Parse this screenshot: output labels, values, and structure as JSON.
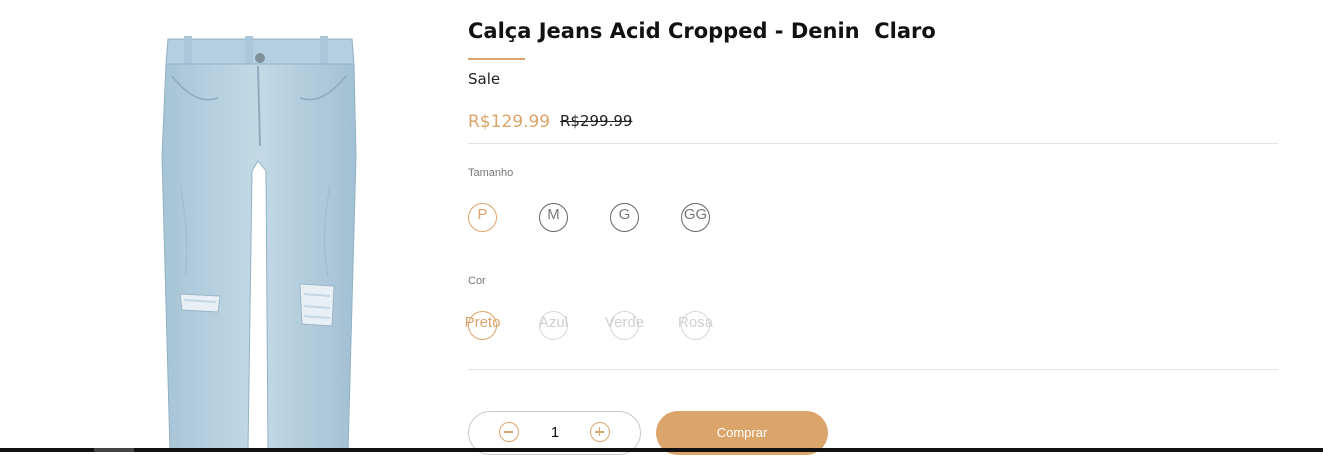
{
  "product": {
    "title": "Calça Jeans Acid Cropped - Denin  Claro",
    "sale_label": "Sale",
    "price_current": "R$129.99",
    "price_old": "R$299.99",
    "image_alt": "jeans-photo"
  },
  "size": {
    "label": "Tamanho",
    "options": [
      "P",
      "M",
      "G",
      "GG"
    ],
    "selected": "P"
  },
  "color": {
    "label": "Cor",
    "options": [
      "Preto",
      "Azul",
      "Verde",
      "Rosa"
    ],
    "selected": "Preto"
  },
  "cart": {
    "quantity": "1",
    "buy_label": "Comprar"
  },
  "colors": {
    "accent": "#dba46a",
    "denim_light": "#b9d3e2",
    "denim_mid": "#9fbfd3"
  }
}
